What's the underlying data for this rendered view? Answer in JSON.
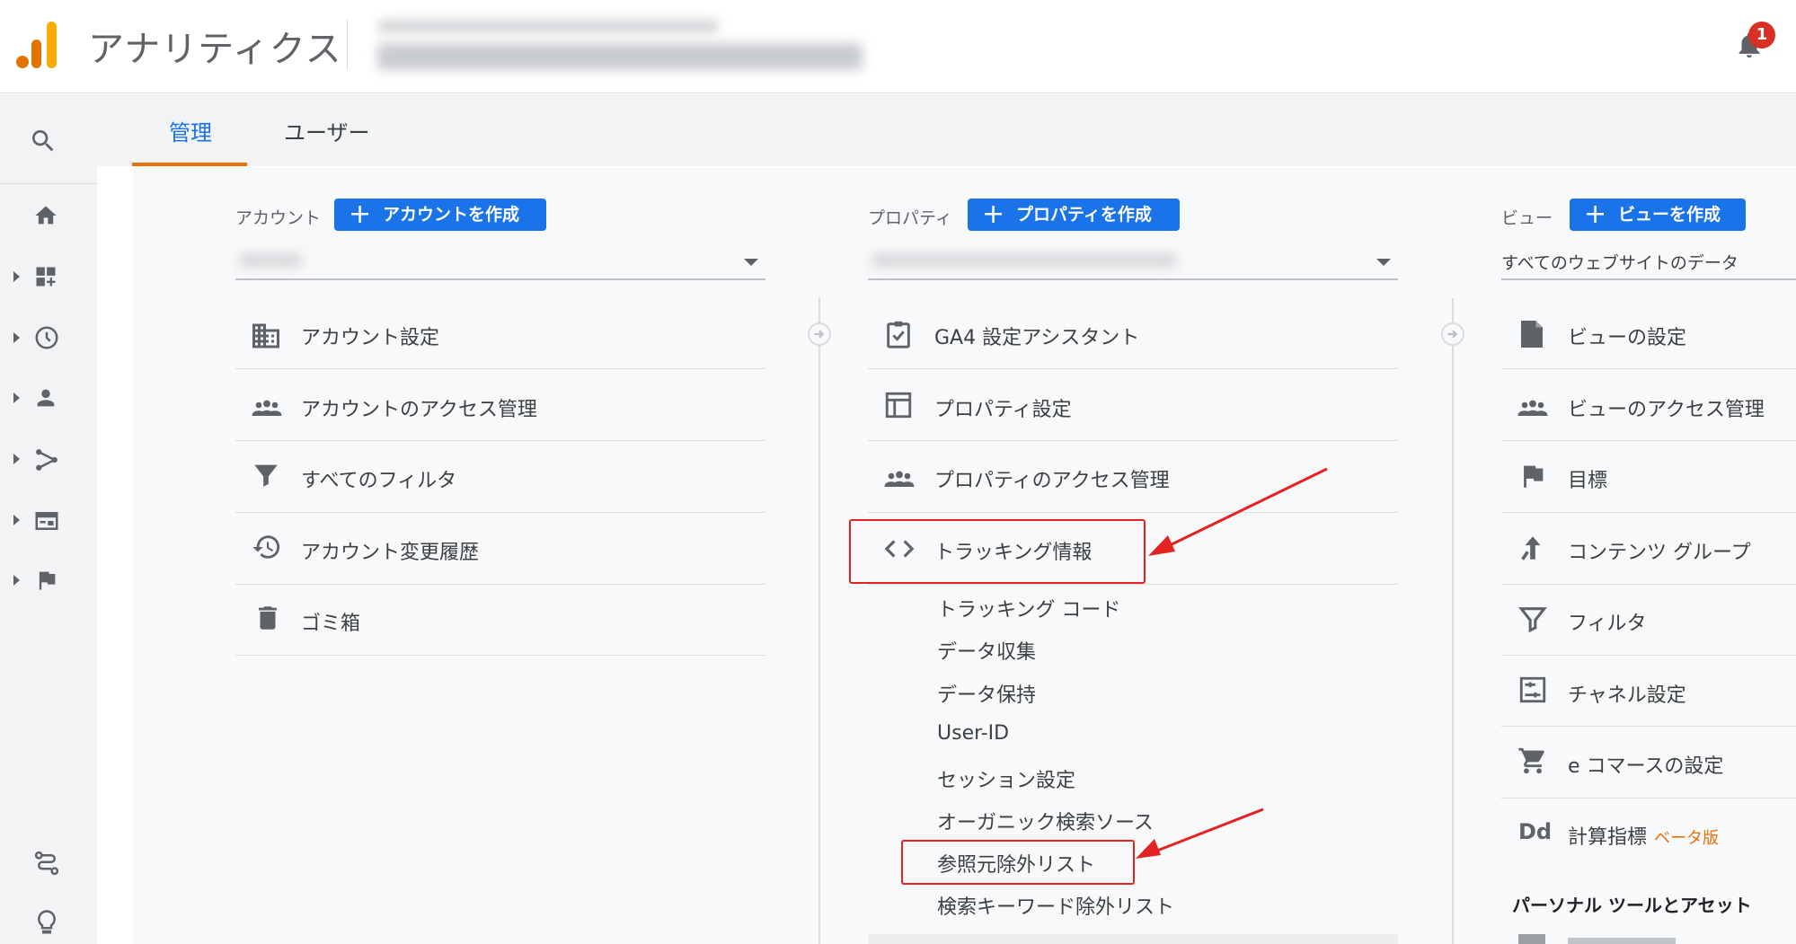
{
  "header": {
    "app_title": "アナリティクス",
    "notification_count": "1",
    "blurred_account_selector": true
  },
  "tabs": [
    {
      "label": "管理",
      "active": true
    },
    {
      "label": "ユーザー",
      "active": false
    }
  ],
  "rail_icons": [
    "search-icon",
    "home-icon",
    "customization-icon",
    "realtime-icon",
    "audience-icon",
    "acquisition-icon",
    "behavior-icon",
    "conversions-icon",
    "attribution-icon",
    "discover-icon"
  ],
  "account": {
    "label": "アカウント",
    "create_button": "アカウントを作成",
    "items": [
      {
        "icon": "building-icon",
        "label": "アカウント設定"
      },
      {
        "icon": "people-icon",
        "label": "アカウントのアクセス管理"
      },
      {
        "icon": "filter-icon",
        "label": "すべてのフィルタ"
      },
      {
        "icon": "history-icon",
        "label": "アカウント変更履歴"
      },
      {
        "icon": "trash-icon",
        "label": "ゴミ箱"
      }
    ]
  },
  "property": {
    "label": "プロパティ",
    "create_button": "プロパティを作成",
    "items": [
      {
        "icon": "checklist-icon",
        "label": "GA4 設定アシスタント"
      },
      {
        "icon": "layout-icon",
        "label": "プロパティ設定"
      },
      {
        "icon": "people-icon",
        "label": "プロパティのアクセス管理"
      },
      {
        "icon": "code-icon",
        "label": "トラッキング情報"
      }
    ],
    "tracking_sub_items": [
      "トラッキング コード",
      "データ収集",
      "データ保持",
      "User-ID",
      "セッション設定",
      "オーガニック検索ソース",
      "参照元除外リスト",
      "検索キーワード除外リスト"
    ]
  },
  "view": {
    "label": "ビュー",
    "create_button": "ビューを作成",
    "selected": "すべてのウェブサイトのデータ",
    "items": [
      {
        "icon": "document-icon",
        "label": "ビューの設定"
      },
      {
        "icon": "people-icon",
        "label": "ビューのアクセス管理"
      },
      {
        "icon": "flag-icon",
        "label": "目標"
      },
      {
        "icon": "content-group-icon",
        "label": "コンテンツ グループ"
      },
      {
        "icon": "filter-icon",
        "label": "フィルタ"
      },
      {
        "icon": "channel-icon",
        "label": "チャネル設定"
      },
      {
        "icon": "cart-icon",
        "label": "e コマースの設定"
      },
      {
        "icon": "calculated-metrics-icon",
        "label": "計算指標",
        "badge": "ベータ版"
      }
    ],
    "section_heading": "パーソナル ツールとアセット"
  },
  "colors": {
    "accent_blue": "#1a73e8",
    "tab_orange": "#e8710a",
    "annotation_red": "#e52222",
    "logo_orange": "#f9ab00",
    "logo_dark_orange": "#e37400"
  }
}
